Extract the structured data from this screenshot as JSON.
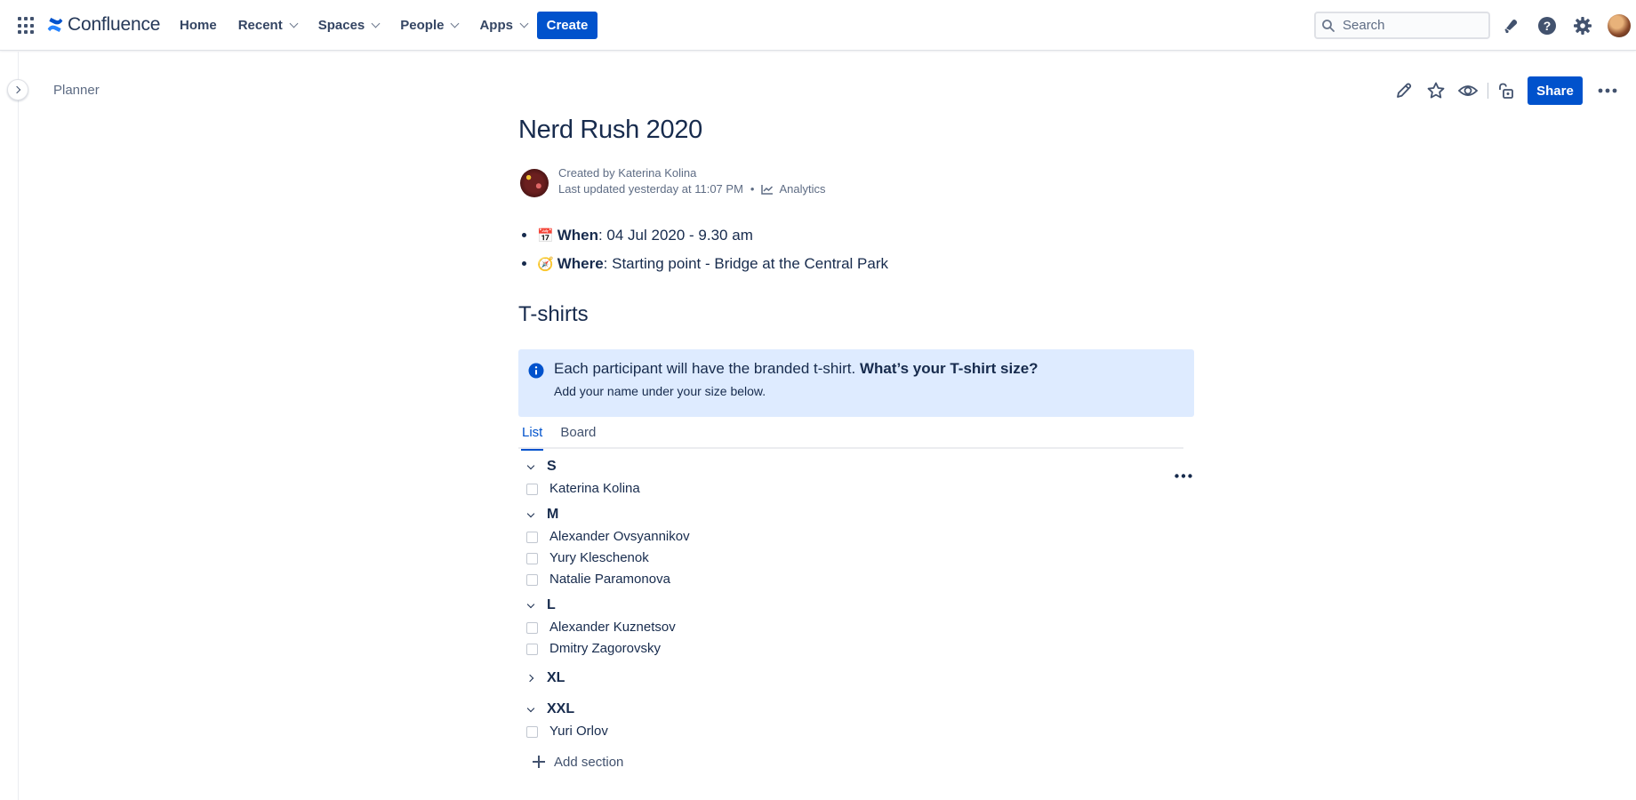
{
  "app": {
    "name": "Confluence",
    "accent": "#0052cc"
  },
  "nav": {
    "home": "Home",
    "recent": "Recent",
    "spaces": "Spaces",
    "people": "People",
    "apps": "Apps",
    "create": "Create"
  },
  "search": {
    "placeholder": "Search",
    "value": ""
  },
  "top_icons": [
    "notifications-icon",
    "help-icon",
    "settings-icon",
    "profile-avatar"
  ],
  "breadcrumb": "Planner",
  "page_actions": {
    "share": "Share",
    "icons": [
      "edit-icon",
      "star-icon",
      "watch-icon",
      "restrictions-icon",
      "more-icon"
    ]
  },
  "page": {
    "title": "Nerd Rush 2020",
    "created_by": "Created by Katerina Kolina",
    "last_updated": "Last updated yesterday at 11:07 PM",
    "separator": "•",
    "analytics": "Analytics",
    "facts": [
      {
        "emoji": "📅",
        "label": "When",
        "value": ": 04 Jul 2020 - 9.30 am"
      },
      {
        "emoji": "🧭",
        "label": "Where",
        "value": ": Starting point - Bridge at the Central Park"
      }
    ],
    "section_title": "T-shirts",
    "info_panel": {
      "text": "Each participant will have the branded t-shirt. ",
      "bold": "What’s your T-shirt size?",
      "subtext": "Add your name under your size below."
    },
    "tabs": [
      {
        "label": "List",
        "active": true
      },
      {
        "label": "Board",
        "active": false
      }
    ],
    "sections": [
      {
        "label": "S",
        "expanded": true,
        "tasks": [
          "Katerina Kolina"
        ]
      },
      {
        "label": "M",
        "expanded": true,
        "tasks": [
          "Alexander Ovsyannikov",
          "Yury Kleschenok",
          "Natalie Paramonova"
        ]
      },
      {
        "label": "L",
        "expanded": true,
        "tasks": [
          "Alexander Kuznetsov",
          "Dmitry Zagorovsky"
        ]
      },
      {
        "label": "XL",
        "expanded": false,
        "tasks": []
      },
      {
        "label": "XXL",
        "expanded": true,
        "tasks": [
          "Yuri Orlov"
        ]
      }
    ],
    "add_section": "Add section"
  }
}
